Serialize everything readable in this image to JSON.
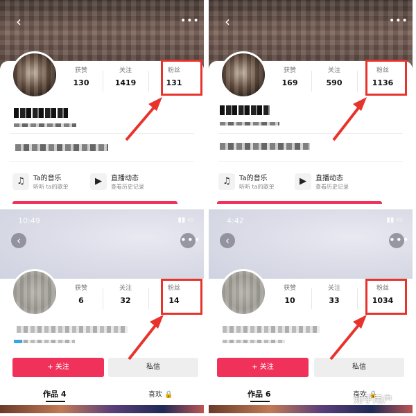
{
  "panels": [
    {
      "stats": [
        {
          "label": "获赞",
          "value": "130"
        },
        {
          "label": "关注",
          "value": "1419"
        },
        {
          "label": "粉丝",
          "value": "131"
        }
      ],
      "services": [
        {
          "title": "Ta的音乐",
          "sub": "听听 ta的歌单",
          "icon": "music-note-icon"
        },
        {
          "title": "直播动态",
          "sub": "查看历史记录",
          "icon": "live-replay-icon"
        }
      ]
    },
    {
      "stats": [
        {
          "label": "获赞",
          "value": "169"
        },
        {
          "label": "关注",
          "value": "590"
        },
        {
          "label": "粉丝",
          "value": "1136"
        }
      ],
      "services": [
        {
          "title": "Ta的音乐",
          "sub": "听听 ta的歌单",
          "icon": "music-note-icon"
        },
        {
          "title": "直播动态",
          "sub": "查看历史记录",
          "icon": "live-replay-icon"
        }
      ]
    },
    {
      "status_time": "10:49",
      "stats": [
        {
          "label": "获赞",
          "value": "6"
        },
        {
          "label": "关注",
          "value": "32"
        },
        {
          "label": "粉丝",
          "value": "14"
        }
      ],
      "follow_label": "+ 关注",
      "message_label": "私信",
      "tabs": [
        "作品 4",
        "喜欢 🔒"
      ]
    },
    {
      "status_time": "4:42",
      "stats": [
        {
          "label": "获赞",
          "value": "10"
        },
        {
          "label": "关注",
          "value": "33"
        },
        {
          "label": "粉丝",
          "value": "1034"
        }
      ],
      "follow_label": "+ 关注",
      "message_label": "私信",
      "tabs": [
        "作品 6",
        "喜欢 🔒"
      ]
    }
  ],
  "watermark": "知乎用户",
  "colors": {
    "accent": "#f0325b",
    "highlight": "#e8332c"
  }
}
